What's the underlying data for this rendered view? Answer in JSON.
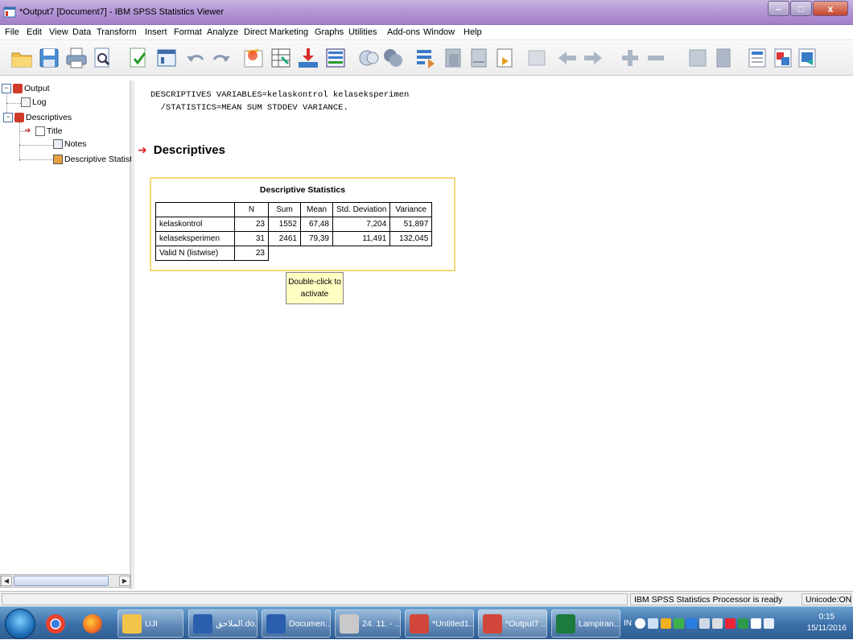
{
  "window": {
    "title": "*Output7 [Document7] - IBM SPSS Statistics Viewer",
    "minimize": "–",
    "maximize": "□",
    "close": "x"
  },
  "menu": [
    "File",
    "Edit",
    "View",
    "Data",
    "Transform",
    "Insert",
    "Format",
    "Analyze",
    "Direct Marketing",
    "Graphs",
    "Utilities",
    "Add-ons",
    "Window",
    "Help"
  ],
  "toolbar": [
    "open-icon",
    "save-icon",
    "print-icon",
    "print-preview-icon",
    "export-icon",
    "recall-dialog-icon",
    "undo-icon",
    "redo-icon",
    "goto-case-icon",
    "goto-variable-icon",
    "variables-icon",
    "run-descriptives-icon",
    "select-last-output-icon",
    "designate-window-icon",
    "syntax-icon",
    "show-all-icon",
    "hide-icon",
    "insert-output-icon",
    "disabled-icon",
    "promote-icon",
    "demote-icon",
    "expand-icon",
    "collapse-icon",
    "show-icon",
    "hide-objects-icon",
    "insert-heading-icon",
    "insert-title-icon",
    "insert-text-icon"
  ],
  "outline": {
    "root": "Output",
    "log": "Log",
    "descriptives": "Descriptives",
    "title": "Title",
    "notes": "Notes",
    "stats": "Descriptive Statist"
  },
  "syntax": {
    "line1": "DESCRIPTIVES VARIABLES=kelaskontrol kelaseksperimen",
    "line2": "  /STATISTICS=MEAN SUM STDDEV VARIANCE."
  },
  "heading": "Descriptives",
  "table": {
    "title": "Descriptive Statistics",
    "headers": [
      "",
      "N",
      "Sum",
      "Mean",
      "Std. Deviation",
      "Variance"
    ],
    "rows": [
      [
        "kelaskontrol",
        "23",
        "1552",
        "67,48",
        "7,204",
        "51,897"
      ],
      [
        "kelaseksperimen",
        "31",
        "2461",
        "79,39",
        "11,491",
        "132,045"
      ],
      [
        "Valid N (listwise)",
        "23",
        "",
        "",
        "",
        ""
      ]
    ]
  },
  "tooltip": {
    "line1": "Double-click to",
    "line2": "activate"
  },
  "status": {
    "processor": "IBM SPSS Statistics Processor is ready",
    "unicode": "Unicode:ON"
  },
  "taskbar": {
    "apps": [
      "UJI",
      "الملاحق.do...",
      "Documen...",
      "24. 11. - ...",
      "*Untitled1...",
      "*Output7 ...",
      "Lampiran..."
    ],
    "lang": "IN",
    "time": "0:15",
    "date": "15/11/2016"
  }
}
